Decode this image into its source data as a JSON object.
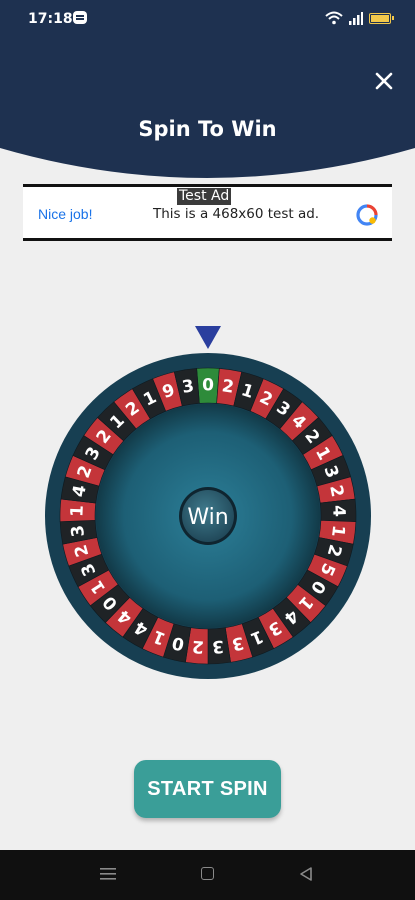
{
  "status_bar": {
    "time": "17:18"
  },
  "header": {
    "title": "Spin To Win",
    "close_icon": "close-icon"
  },
  "ad": {
    "label": "Test Ad",
    "headline": "Nice job!",
    "text": "This is a 468x60 test ad."
  },
  "wheel": {
    "center_label": "Win",
    "numbers": [
      "0",
      "2",
      "1",
      "2",
      "3",
      "4",
      "2",
      "1",
      "3",
      "2",
      "4",
      "1",
      "2",
      "5",
      "0",
      "1",
      "4",
      "3",
      "1",
      "3",
      "3",
      "2",
      "0",
      "1",
      "4",
      "4",
      "0",
      "1",
      "3",
      "2",
      "3",
      "1",
      "4",
      "2",
      "3",
      "2",
      "1",
      "2",
      "1",
      "9",
      "3"
    ],
    "segment_colors": [
      "green",
      "red",
      "black",
      "red",
      "black",
      "red",
      "black",
      "red",
      "black",
      "red",
      "black",
      "red",
      "black",
      "red",
      "black",
      "red",
      "black",
      "red",
      "black",
      "red",
      "black",
      "red",
      "black",
      "red",
      "black",
      "red",
      "black",
      "red",
      "black",
      "red",
      "black",
      "red",
      "black",
      "red",
      "black",
      "red",
      "black",
      "red",
      "black",
      "red",
      "black"
    ],
    "colors": {
      "red": "#c4353a",
      "black": "#1f2326",
      "green": "#2e8b3a",
      "rim": "#173f52",
      "inner": "#1c5c73"
    }
  },
  "start_button": {
    "label": "START SPIN"
  },
  "colors": {
    "header": "#1e3150",
    "button": "#3a9e98",
    "pointer": "#2a3e9e"
  }
}
